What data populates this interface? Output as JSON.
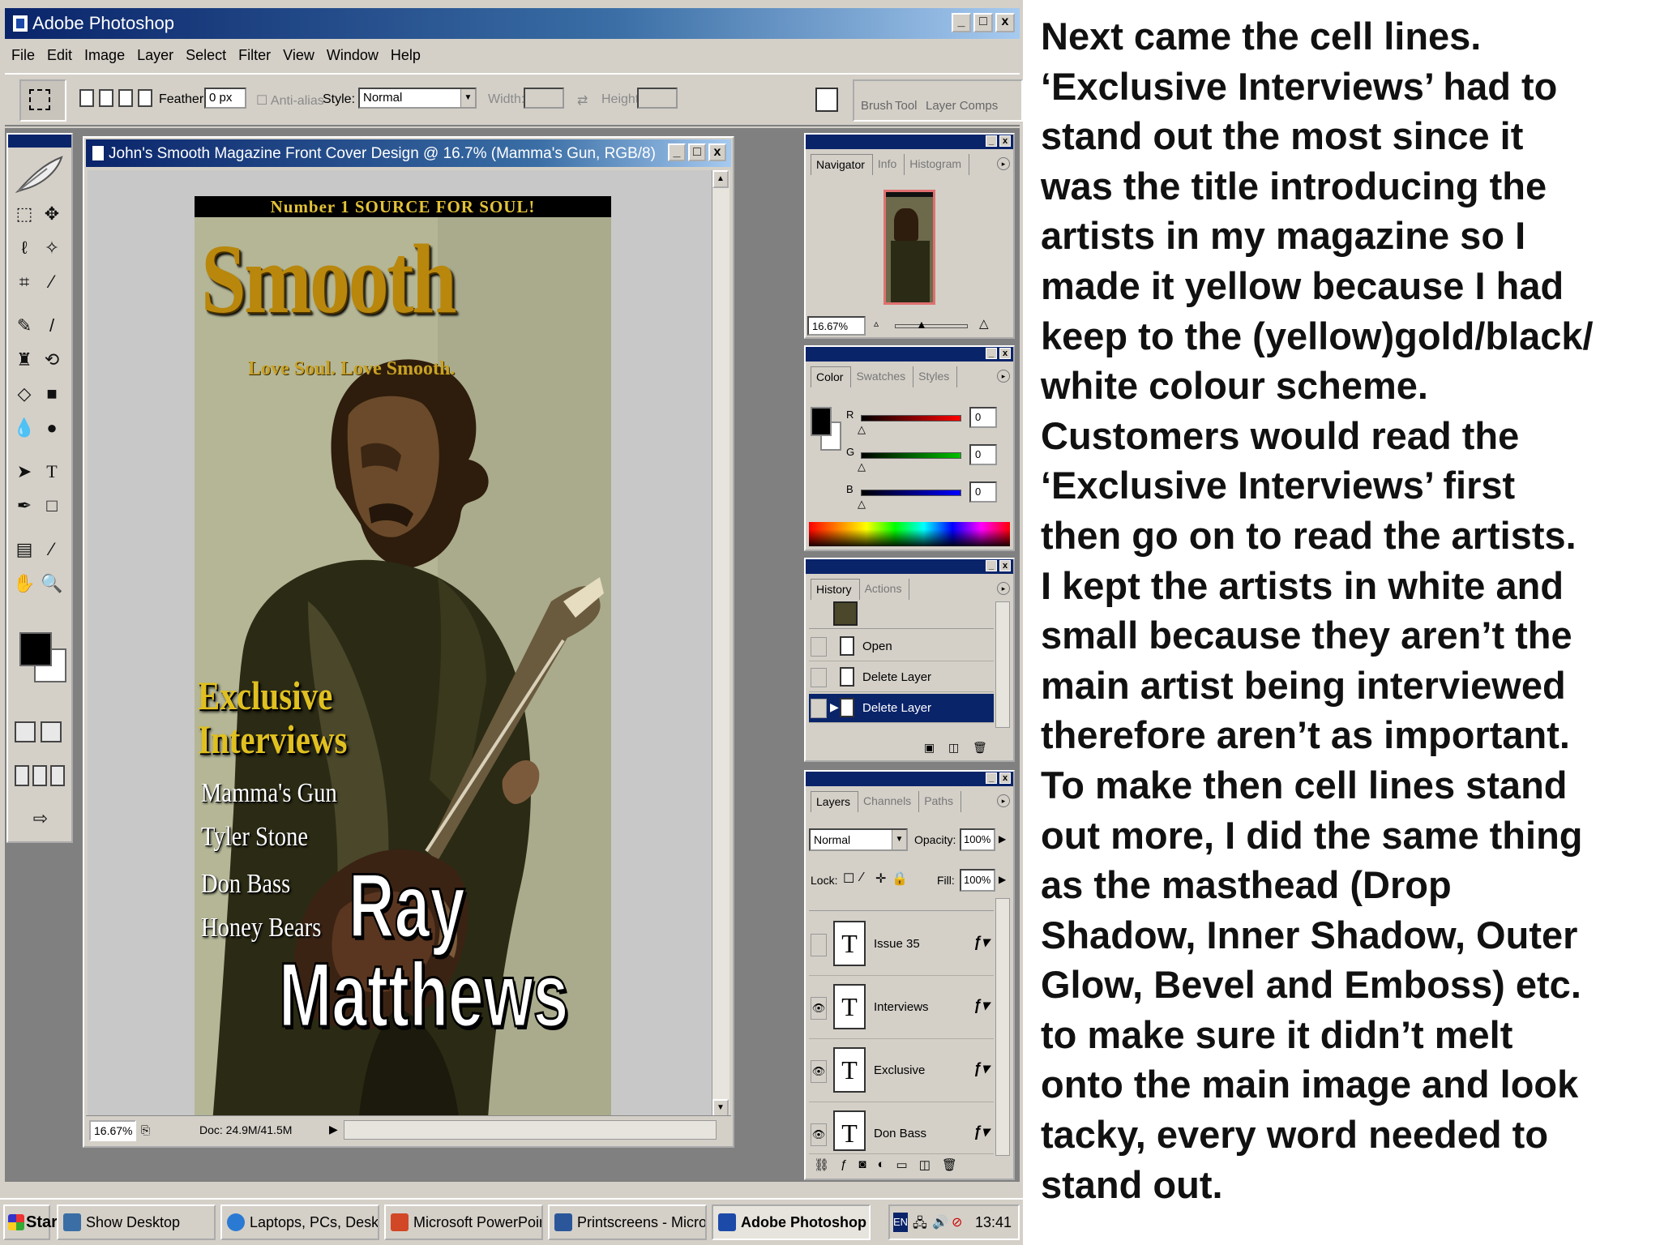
{
  "app": {
    "title": "Adobe Photoshop",
    "window_controls": [
      "_",
      "□",
      "x"
    ]
  },
  "menubar": [
    "File",
    "Edit",
    "Image",
    "Layer",
    "Select",
    "Filter",
    "View",
    "Window",
    "Help"
  ],
  "options_bar": {
    "feather_label": "Feather:",
    "feather_value": "0 px",
    "antialias_label": "Anti-alias",
    "style_label": "Style:",
    "style_value": "Normal",
    "width_label": "Width:",
    "height_label": "Height:",
    "palette_well_tabs": [
      "Brush",
      "Tool",
      "Layer Comps"
    ]
  },
  "document": {
    "title": "John's Smooth Magazine Front Cover Design @ 16.7% (Mamma's Gun, RGB/8)",
    "zoom": "16.67%",
    "doc_info": "Doc: 24.9M/41.5M"
  },
  "cover": {
    "banner": "Number 1 SOURCE FOR SOUL!",
    "masthead": "Smooth",
    "tagline": "Love Soul. Love Smooth.",
    "cell_line_1": "Exclusive",
    "cell_line_2": "Interviews",
    "artists": [
      "Mamma's Gun",
      "Tyler Stone",
      "Don Bass",
      "Honey Bears"
    ],
    "main_name_1": "Ray",
    "main_name_2": "Matthews"
  },
  "navigator": {
    "tabs": [
      "Navigator",
      "Info",
      "Histogram"
    ],
    "zoom": "16.67%"
  },
  "color_palette": {
    "tabs": [
      "Color",
      "Swatches",
      "Styles"
    ],
    "channels": [
      {
        "label": "R",
        "value": "0",
        "color": "#ff0000"
      },
      {
        "label": "G",
        "value": "0",
        "color": "#00c000"
      },
      {
        "label": "B",
        "value": "0",
        "color": "#0000ff"
      }
    ]
  },
  "history": {
    "tabs": [
      "History",
      "Actions"
    ],
    "items": [
      "Open",
      "Delete Layer",
      "Delete Layer"
    ],
    "selected_index": 2
  },
  "layers": {
    "tabs": [
      "Layers",
      "Channels",
      "Paths"
    ],
    "blend_mode": "Normal",
    "opacity_label": "Opacity:",
    "opacity": "100%",
    "lock_label": "Lock:",
    "fill_label": "Fill:",
    "fill": "100%",
    "items": [
      "Issue 35",
      "Interviews",
      "Exclusive",
      "Don Bass"
    ]
  },
  "taskbar": {
    "start": "Start",
    "buttons": [
      "Show Desktop",
      "Laptops, PCs, Desktop C...",
      "Microsoft PowerPoint - [Pr...",
      "Printscreens - Microsoft ...",
      "Adobe Photoshop"
    ],
    "tray_lang": "EN",
    "clock": "13:41"
  },
  "notes": {
    "lines": [
      "Next came the cell lines.",
      "‘Exclusive Interviews’ had to",
      "stand out the most since it",
      "was the title introducing the",
      "artists in my magazine so I",
      "made it yellow because I had",
      "keep to the (yellow)gold/black/",
      "white colour scheme.",
      "Customers would read the",
      "‘Exclusive Interviews’ first",
      "then go on to read the artists.",
      "I kept the artists in white and",
      "small because they aren’t the",
      "main artist being interviewed",
      "therefore aren’t as important.",
      "To make then cell lines stand",
      "out more, I did the same thing",
      "as the masthead (Drop",
      "Shadow, Inner Shadow, Outer",
      "Glow, Bevel and Emboss) etc.",
      "to make sure it didn’t melt",
      "onto the main image and look",
      "tacky, every word needed to",
      "stand out."
    ]
  }
}
